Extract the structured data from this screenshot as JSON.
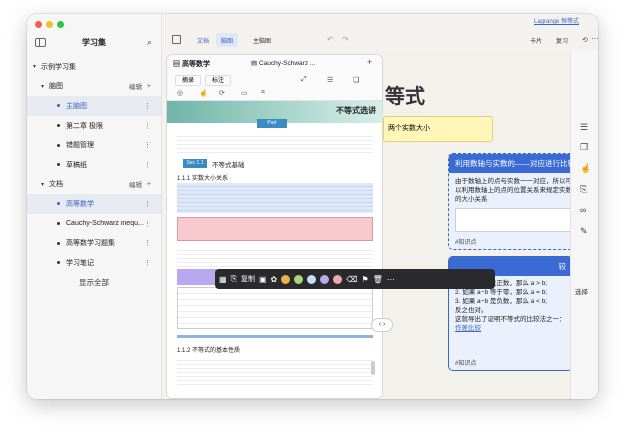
{
  "sidebar": {
    "title": "学习集",
    "items": [
      {
        "label": "示例学习集",
        "caret": "▾",
        "indent": 0
      },
      {
        "label": "脑图",
        "caret": "▾",
        "indent": 1,
        "action": "编辑",
        "plus": "+"
      },
      {
        "label": "主脑图",
        "indent": 2,
        "selected": true
      },
      {
        "label": "第二章 极限",
        "indent": 2
      },
      {
        "label": "错题管理",
        "indent": 2
      },
      {
        "label": "草稿纸",
        "indent": 2
      },
      {
        "label": "文档",
        "caret": "▾",
        "indent": 1,
        "action": "编辑",
        "plus": "+"
      },
      {
        "label": "高等数学",
        "indent": 2,
        "selected": true
      },
      {
        "label": "Cauchy-Schwarz inequ...",
        "indent": 2
      },
      {
        "label": "高等数学习题集",
        "indent": 2
      },
      {
        "label": "学习笔记",
        "indent": 2
      }
    ],
    "show_all": "显示全部"
  },
  "toolbar": {
    "tab_doc": "文档",
    "tab_mindmap": "脑图",
    "main_mindmap": "主脑图",
    "card": "卡片",
    "review": "复习",
    "link": "Lagrange 恒等式"
  },
  "pdf": {
    "doc1": "高等数学",
    "doc2": "Cauchy-Schwarz ...",
    "tab_excerpt": "摘录",
    "tab_annotate": "标注",
    "banner": "不等式选讲",
    "part": "Part",
    "section": "Sec 1.1",
    "section_title": "不等式基础",
    "sub": "1.1.1  实数大小关系",
    "sub2": "1.1.2  不等式的基本性质"
  },
  "mindmap": {
    "heading_fragment": "等式",
    "yellow_note": "两个实数大小",
    "card1_title": "利用数轴与实数的——对应进行比较",
    "card1_body": "由于数轴上的点与实数一一对应，所以可以利用数轴上的点的位置关系来规定实数的大小关系",
    "card1_tag": "#知识点",
    "card2_title": "较",
    "card2_lines": [
      "1. 如果 a−b 是正数，那么 a > b;",
      "2. 如果 a−b 等于零，那么 a = b;",
      "3. 如果 a−b 是负数，那么 a < b;",
      "反之也对。"
    ],
    "card2_link_text": "这就导出了证明不等式的比较法之一：",
    "card2_link": "作差比较",
    "card2_tag": "#知识点"
  },
  "floating_toolbar": {
    "btn1": "复制",
    "colors": [
      "#e9b24a",
      "#a7d77a",
      "#c6dff8",
      "#b9a7f0",
      "#f0a7b0"
    ]
  },
  "rail": {
    "select": "选择"
  }
}
